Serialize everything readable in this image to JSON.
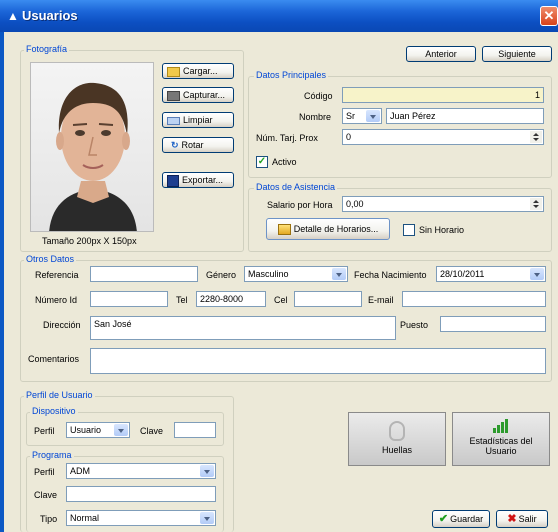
{
  "window": {
    "title": "Usuarios",
    "close": "✕"
  },
  "nav": {
    "prev": "Anterior",
    "next": "Siguiente"
  },
  "photo": {
    "legend": "Fotografía",
    "size_label": "Tamaño 200px X 150px",
    "buttons": {
      "load": "Cargar...",
      "capture": "Capturar...",
      "clear": "Limpiar",
      "rotate": "Rotar",
      "export": "Exportar..."
    }
  },
  "principal": {
    "legend": "Datos Principales",
    "code_label": "Código",
    "code_value": "1",
    "name_label": "Nombre",
    "title_value": "Sr",
    "name_value": "Juan Pérez",
    "card_label": "Núm. Tarj. Prox",
    "card_value": "0",
    "active_label": "Activo",
    "active_checked": true
  },
  "attendance": {
    "legend": "Datos de Asistencia",
    "salary_label": "Salario por Hora",
    "salary_value": "0,00",
    "schedule_button": "Detalle de Horarios...",
    "no_schedule_label": "Sin Horario",
    "no_schedule_checked": false
  },
  "other": {
    "legend": "Otros Datos",
    "reference_label": "Referencia",
    "reference_value": "",
    "gender_label": "Género",
    "gender_value": "Masculino",
    "birth_label": "Fecha Nacimiento",
    "birth_value": "28/10/2011",
    "id_label": "Número Id",
    "id_value": "",
    "phone_label": "Tel",
    "phone_value": "2280-8000",
    "cell_label": "Cel",
    "cell_value": "",
    "email_label": "E-mail",
    "email_value": "",
    "address_label": "Dirección",
    "address_value": "San José",
    "position_label": "Puesto",
    "position_value": "",
    "comments_label": "Comentarios",
    "comments_value": ""
  },
  "profile": {
    "legend": "Perfil de Usuario",
    "device_legend": "Dispositivo",
    "device_profile_label": "Perfil",
    "device_profile_value": "Usuario",
    "device_key_label": "Clave",
    "device_key_value": "",
    "program_legend": "Programa",
    "program_profile_label": "Perfil",
    "program_profile_value": "ADM",
    "program_key_label": "Clave",
    "program_key_value": "",
    "type_label": "Tipo",
    "type_value": "Normal"
  },
  "actions": {
    "fingerprints": "Huellas",
    "stats": "Estadísticas del Usuario",
    "save": "Guardar",
    "exit": "Salir"
  },
  "colors": {
    "title_bar": "#0c4fc2",
    "legend": "#0046d5",
    "code_bg": "#f7f3c9"
  }
}
